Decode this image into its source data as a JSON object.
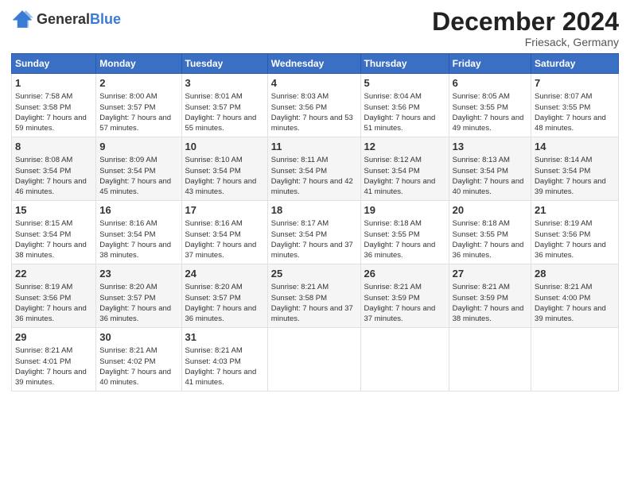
{
  "logo": {
    "general": "General",
    "blue": "Blue"
  },
  "title": "December 2024",
  "subtitle": "Friesack, Germany",
  "days": [
    "Sunday",
    "Monday",
    "Tuesday",
    "Wednesday",
    "Thursday",
    "Friday",
    "Saturday"
  ],
  "weeks": [
    [
      {
        "day": "1",
        "sunrise": "Sunrise: 7:58 AM",
        "sunset": "Sunset: 3:58 PM",
        "daylight": "Daylight: 7 hours and 59 minutes."
      },
      {
        "day": "2",
        "sunrise": "Sunrise: 8:00 AM",
        "sunset": "Sunset: 3:57 PM",
        "daylight": "Daylight: 7 hours and 57 minutes."
      },
      {
        "day": "3",
        "sunrise": "Sunrise: 8:01 AM",
        "sunset": "Sunset: 3:57 PM",
        "daylight": "Daylight: 7 hours and 55 minutes."
      },
      {
        "day": "4",
        "sunrise": "Sunrise: 8:03 AM",
        "sunset": "Sunset: 3:56 PM",
        "daylight": "Daylight: 7 hours and 53 minutes."
      },
      {
        "day": "5",
        "sunrise": "Sunrise: 8:04 AM",
        "sunset": "Sunset: 3:56 PM",
        "daylight": "Daylight: 7 hours and 51 minutes."
      },
      {
        "day": "6",
        "sunrise": "Sunrise: 8:05 AM",
        "sunset": "Sunset: 3:55 PM",
        "daylight": "Daylight: 7 hours and 49 minutes."
      },
      {
        "day": "7",
        "sunrise": "Sunrise: 8:07 AM",
        "sunset": "Sunset: 3:55 PM",
        "daylight": "Daylight: 7 hours and 48 minutes."
      }
    ],
    [
      {
        "day": "8",
        "sunrise": "Sunrise: 8:08 AM",
        "sunset": "Sunset: 3:54 PM",
        "daylight": "Daylight: 7 hours and 46 minutes."
      },
      {
        "day": "9",
        "sunrise": "Sunrise: 8:09 AM",
        "sunset": "Sunset: 3:54 PM",
        "daylight": "Daylight: 7 hours and 45 minutes."
      },
      {
        "day": "10",
        "sunrise": "Sunrise: 8:10 AM",
        "sunset": "Sunset: 3:54 PM",
        "daylight": "Daylight: 7 hours and 43 minutes."
      },
      {
        "day": "11",
        "sunrise": "Sunrise: 8:11 AM",
        "sunset": "Sunset: 3:54 PM",
        "daylight": "Daylight: 7 hours and 42 minutes."
      },
      {
        "day": "12",
        "sunrise": "Sunrise: 8:12 AM",
        "sunset": "Sunset: 3:54 PM",
        "daylight": "Daylight: 7 hours and 41 minutes."
      },
      {
        "day": "13",
        "sunrise": "Sunrise: 8:13 AM",
        "sunset": "Sunset: 3:54 PM",
        "daylight": "Daylight: 7 hours and 40 minutes."
      },
      {
        "day": "14",
        "sunrise": "Sunrise: 8:14 AM",
        "sunset": "Sunset: 3:54 PM",
        "daylight": "Daylight: 7 hours and 39 minutes."
      }
    ],
    [
      {
        "day": "15",
        "sunrise": "Sunrise: 8:15 AM",
        "sunset": "Sunset: 3:54 PM",
        "daylight": "Daylight: 7 hours and 38 minutes."
      },
      {
        "day": "16",
        "sunrise": "Sunrise: 8:16 AM",
        "sunset": "Sunset: 3:54 PM",
        "daylight": "Daylight: 7 hours and 38 minutes."
      },
      {
        "day": "17",
        "sunrise": "Sunrise: 8:16 AM",
        "sunset": "Sunset: 3:54 PM",
        "daylight": "Daylight: 7 hours and 37 minutes."
      },
      {
        "day": "18",
        "sunrise": "Sunrise: 8:17 AM",
        "sunset": "Sunset: 3:54 PM",
        "daylight": "Daylight: 7 hours and 37 minutes."
      },
      {
        "day": "19",
        "sunrise": "Sunrise: 8:18 AM",
        "sunset": "Sunset: 3:55 PM",
        "daylight": "Daylight: 7 hours and 36 minutes."
      },
      {
        "day": "20",
        "sunrise": "Sunrise: 8:18 AM",
        "sunset": "Sunset: 3:55 PM",
        "daylight": "Daylight: 7 hours and 36 minutes."
      },
      {
        "day": "21",
        "sunrise": "Sunrise: 8:19 AM",
        "sunset": "Sunset: 3:56 PM",
        "daylight": "Daylight: 7 hours and 36 minutes."
      }
    ],
    [
      {
        "day": "22",
        "sunrise": "Sunrise: 8:19 AM",
        "sunset": "Sunset: 3:56 PM",
        "daylight": "Daylight: 7 hours and 36 minutes."
      },
      {
        "day": "23",
        "sunrise": "Sunrise: 8:20 AM",
        "sunset": "Sunset: 3:57 PM",
        "daylight": "Daylight: 7 hours and 36 minutes."
      },
      {
        "day": "24",
        "sunrise": "Sunrise: 8:20 AM",
        "sunset": "Sunset: 3:57 PM",
        "daylight": "Daylight: 7 hours and 36 minutes."
      },
      {
        "day": "25",
        "sunrise": "Sunrise: 8:21 AM",
        "sunset": "Sunset: 3:58 PM",
        "daylight": "Daylight: 7 hours and 37 minutes."
      },
      {
        "day": "26",
        "sunrise": "Sunrise: 8:21 AM",
        "sunset": "Sunset: 3:59 PM",
        "daylight": "Daylight: 7 hours and 37 minutes."
      },
      {
        "day": "27",
        "sunrise": "Sunrise: 8:21 AM",
        "sunset": "Sunset: 3:59 PM",
        "daylight": "Daylight: 7 hours and 38 minutes."
      },
      {
        "day": "28",
        "sunrise": "Sunrise: 8:21 AM",
        "sunset": "Sunset: 4:00 PM",
        "daylight": "Daylight: 7 hours and 39 minutes."
      }
    ],
    [
      {
        "day": "29",
        "sunrise": "Sunrise: 8:21 AM",
        "sunset": "Sunset: 4:01 PM",
        "daylight": "Daylight: 7 hours and 39 minutes."
      },
      {
        "day": "30",
        "sunrise": "Sunrise: 8:21 AM",
        "sunset": "Sunset: 4:02 PM",
        "daylight": "Daylight: 7 hours and 40 minutes."
      },
      {
        "day": "31",
        "sunrise": "Sunrise: 8:21 AM",
        "sunset": "Sunset: 4:03 PM",
        "daylight": "Daylight: 7 hours and 41 minutes."
      },
      {
        "day": "",
        "sunrise": "",
        "sunset": "",
        "daylight": ""
      },
      {
        "day": "",
        "sunrise": "",
        "sunset": "",
        "daylight": ""
      },
      {
        "day": "",
        "sunrise": "",
        "sunset": "",
        "daylight": ""
      },
      {
        "day": "",
        "sunrise": "",
        "sunset": "",
        "daylight": ""
      }
    ]
  ]
}
